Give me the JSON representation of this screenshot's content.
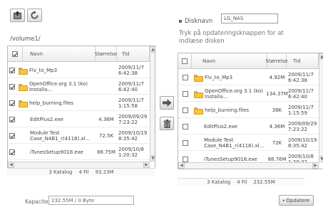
{
  "toolbar": {
    "upload_icon": "upload-icon",
    "refresh_icon": "refresh-icon"
  },
  "left": {
    "path": "/volume1/",
    "columns": {
      "name": "Navn",
      "size": "Størrelse",
      "time": "Tid"
    },
    "rows": [
      {
        "type": "folder",
        "checked": true,
        "name": "Flv_to_Mp3",
        "size": "",
        "time": "2009/11/7 6:42:38"
      },
      {
        "type": "folder",
        "checked": true,
        "name": "OpenOffice.org 3.1 (ko) Installa...",
        "size": "",
        "time": "2009/11/7 6:42:40"
      },
      {
        "type": "folder",
        "checked": true,
        "name": "help_burning.files",
        "size": "",
        "time": "2009/11/7 1:15:58"
      },
      {
        "type": "file",
        "checked": true,
        "name": "EditPlus2.exe",
        "size": "4.36M",
        "time": "2009/09/29 7:23:22"
      },
      {
        "type": "file",
        "checked": true,
        "name": "Module Test Case_N4B1_r(4118).xl...",
        "size": "72.5K",
        "time": "2009/10/19 8:35:42"
      },
      {
        "type": "file",
        "checked": true,
        "name": "iTunesSetup9018.exe",
        "size": "88.75M",
        "time": "2009/10/8 1:20:32"
      }
    ],
    "footer": {
      "folders": "3 Katalog",
      "files": "4 Fil",
      "total": "93.23M"
    }
  },
  "middle": {
    "copy_icon": "arrow-right-icon",
    "delete_icon": "trash-icon"
  },
  "right": {
    "disk_label": "Disknavn",
    "disk_name": "LG_NAS",
    "hint": "Tryk på opdateringsknappen for at indlæse disken",
    "columns": {
      "name": "Navn",
      "size": "Størrelse",
      "time": "Tid"
    },
    "rows": [
      {
        "type": "folder",
        "checked": false,
        "name": "Flv_to_Mp3",
        "size": "4.92M",
        "time": "2009/11/7 6:42:38"
      },
      {
        "type": "folder",
        "checked": false,
        "name": "OpenOffice.org 3.1 (ko) Installa...",
        "size": "134.37M",
        "time": "2009/11/7 6:42:40"
      },
      {
        "type": "folder",
        "checked": false,
        "name": "help_burning.files",
        "size": "36K",
        "time": "2009/11/7 1:15:59"
      },
      {
        "type": "file",
        "checked": false,
        "name": "EditPlus2.exe",
        "size": "4.36M",
        "time": "2009/09/29 7:23:22"
      },
      {
        "type": "file",
        "checked": false,
        "name": "Module Test Case_N4B1_r(4118).xl...",
        "size": "72K",
        "time": "2009/10/19 8:35:42"
      },
      {
        "type": "file",
        "checked": false,
        "name": "iTunesSetup9018.exe",
        "size": "88.76M",
        "time": "2009/10/8 1:20:32"
      }
    ],
    "footer": {
      "folders": "3 Katalog",
      "files": "4 Fil",
      "total": "232.55M"
    }
  },
  "capacity": {
    "label": "Kapacitet",
    "value": "232.55M / 0 Byte"
  },
  "update_button": {
    "label": "Opdatere"
  },
  "colors": {
    "folder": "#f5c542",
    "border": "#b8b8b8"
  }
}
